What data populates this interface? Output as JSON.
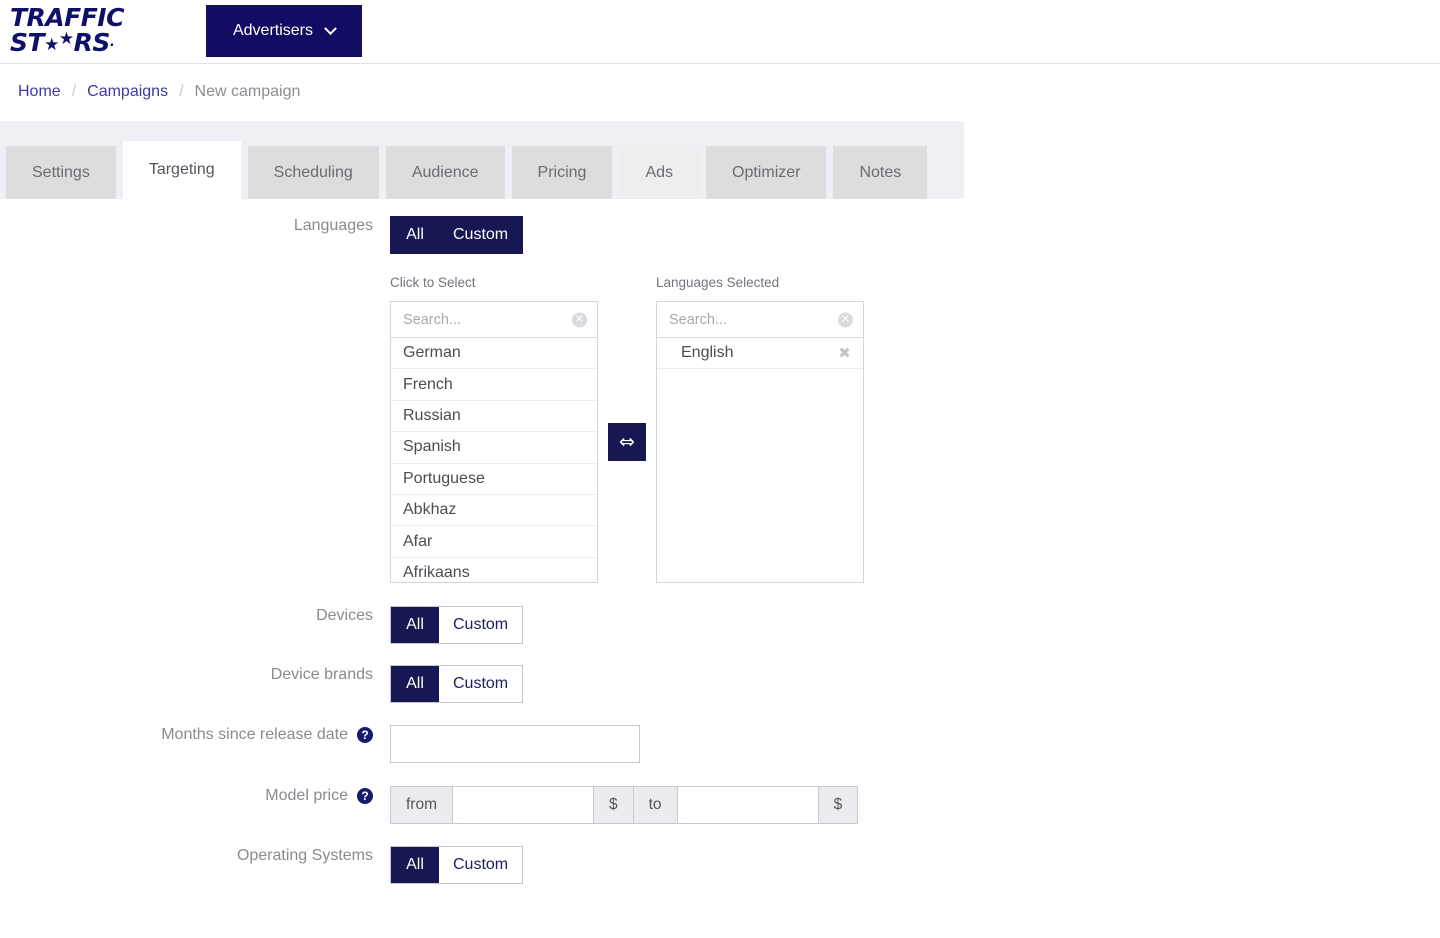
{
  "header": {
    "logo": {
      "line1": "TRAFFIC",
      "line2_pre": "ST",
      "line2_post": "RS",
      "star": "★",
      "dot": "."
    },
    "advertisers_button": "Advertisers",
    "caret_icon": "chevron-down-icon"
  },
  "breadcrumb": {
    "items": [
      {
        "label": "Home",
        "current": false
      },
      {
        "label": "Campaigns",
        "current": false
      },
      {
        "label": "New campaign",
        "current": true
      }
    ],
    "separator": "/"
  },
  "tabs": [
    {
      "label": "Settings",
      "state": "normal"
    },
    {
      "label": "Targeting",
      "state": "active"
    },
    {
      "label": "Scheduling",
      "state": "normal"
    },
    {
      "label": "Audience",
      "state": "normal"
    },
    {
      "label": "Pricing",
      "state": "normal"
    },
    {
      "label": "Ads",
      "state": "hovered"
    },
    {
      "label": "Optimizer",
      "state": "normal"
    },
    {
      "label": "Notes",
      "state": "normal"
    }
  ],
  "form": {
    "languages": {
      "label": "Languages",
      "toggle": {
        "all": "All",
        "custom": "Custom",
        "selected": "Custom"
      },
      "available_panel": {
        "title": "Click to Select",
        "search_placeholder": "Search...",
        "search_value": "",
        "clear_icon": "clear-circle-icon",
        "options": [
          "German",
          "French",
          "Russian",
          "Spanish",
          "Portuguese",
          "Abkhaz",
          "Afar",
          "Afrikaans"
        ]
      },
      "swap_icon": "swap-left-right-arrow-icon",
      "swap_glyph": "⇔",
      "selected_panel": {
        "title": "Languages Selected",
        "search_placeholder": "Search...",
        "search_value": "",
        "clear_icon": "clear-circle-icon",
        "remove_glyph": "✖",
        "options": [
          "English"
        ]
      }
    },
    "devices": {
      "label": "Devices",
      "toggle": {
        "all": "All",
        "custom": "Custom",
        "selected": "All"
      }
    },
    "device_brands": {
      "label": "Device brands",
      "toggle": {
        "all": "All",
        "custom": "Custom",
        "selected": "All"
      }
    },
    "months_since_release": {
      "label": "Months since release date",
      "help_icon": "question-mark-icon",
      "help_glyph": "?",
      "value": "",
      "placeholder": ""
    },
    "model_price": {
      "label": "Model price",
      "help_icon": "question-mark-icon",
      "help_glyph": "?",
      "from_addon": "from",
      "from_value": "",
      "from_currency": "$",
      "to_addon": "to",
      "to_value": "",
      "to_currency": "$"
    },
    "operating_systems": {
      "label": "Operating Systems",
      "toggle": {
        "all": "All",
        "custom": "Custom",
        "selected": "All"
      }
    }
  },
  "colors": {
    "brand_navy": "#120c62",
    "toggle_navy": "#171753",
    "tab_grey": "#dddddd",
    "tab_strip_bg": "#eff0f5",
    "link_indigo": "#3b3ba8"
  }
}
